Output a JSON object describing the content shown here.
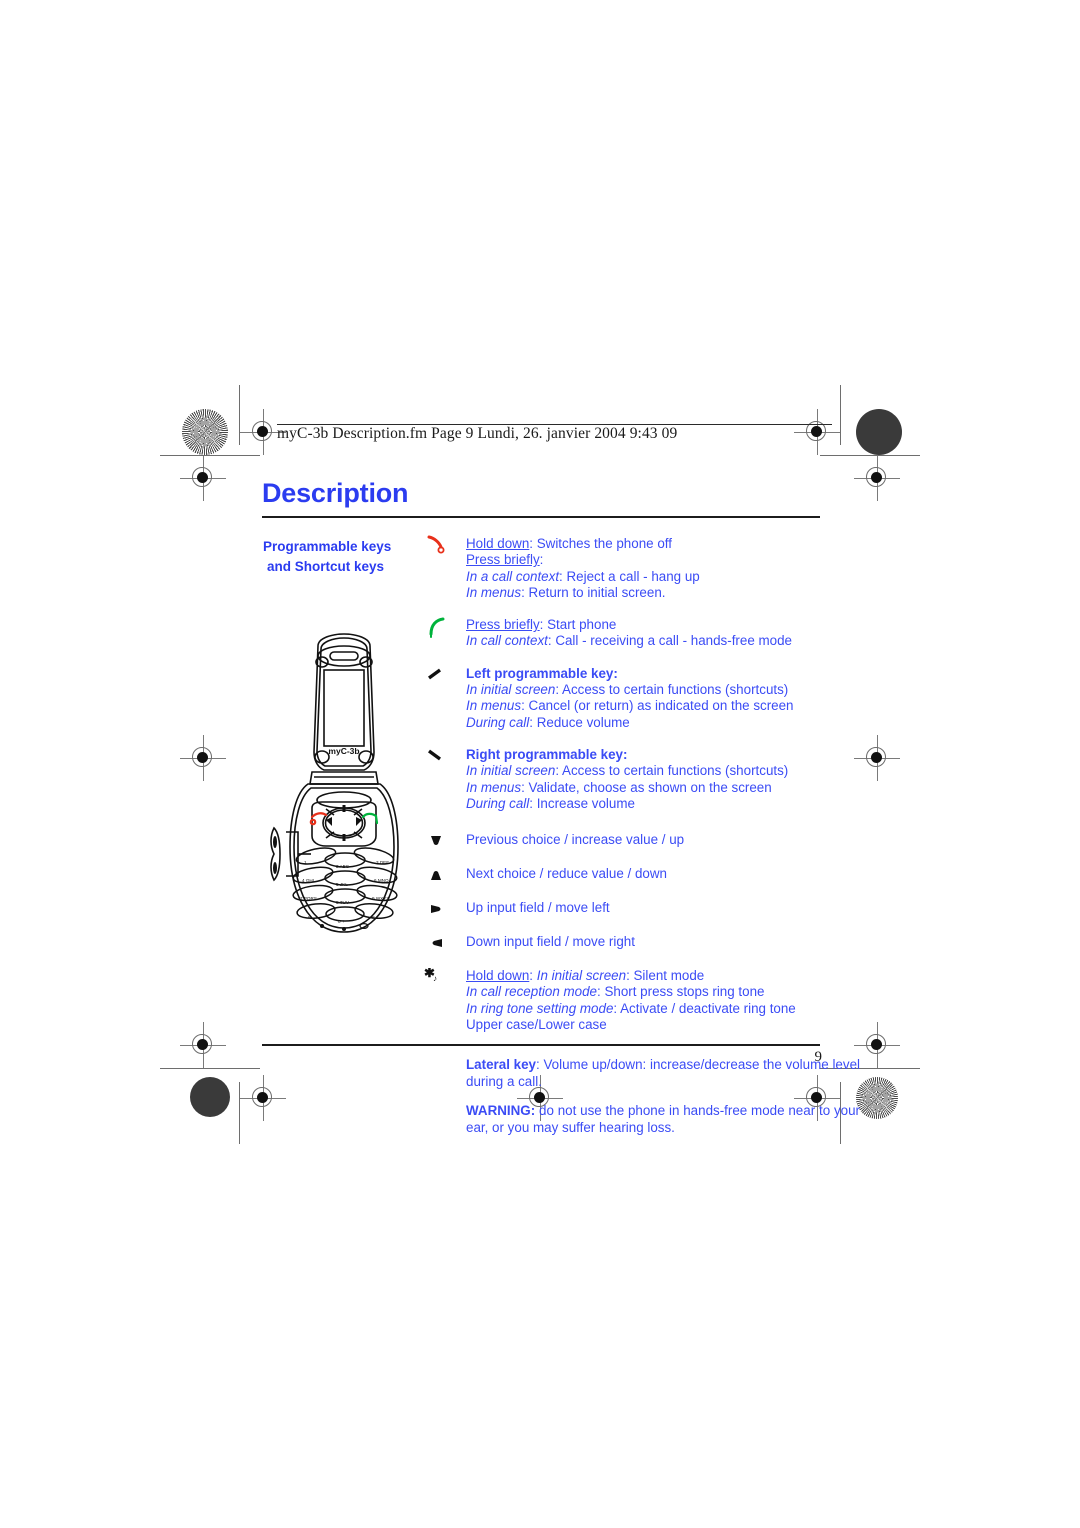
{
  "document": {
    "file_stamp": "myC-3b Description.fm  Page 9  Lundi, 26. janvier 2004  9:43 09",
    "title": "Description",
    "page_number": "9"
  },
  "sidebar": {
    "line1": "Programmable keys",
    "line2": "and  Shortcut keys"
  },
  "entries": [
    {
      "icon": "hang-up-icon",
      "lines": [
        "Hold down: Switches the phone off",
        "Press briefly:",
        "In a call context: Reject a call - hang up",
        "In menus: Return to initial screen."
      ]
    },
    {
      "icon": "call-icon",
      "lines": [
        "Press briefly: Start phone",
        "In call context: Call - receiving a call - hands-free mode"
      ]
    },
    {
      "icon": "left-programmable-key-icon",
      "lines": [
        "Left programmable key:",
        "In initial screen: Access to certain functions (shortcuts)",
        "In menus: Cancel (or return) as indicated on the screen",
        "During call: Reduce volume"
      ]
    },
    {
      "icon": "right-programmable-key-icon",
      "lines": [
        "Right programmable key:",
        "In initial screen: Access to certain functions (shortcuts)",
        "In menus: Validate, choose as shown on the screen",
        "During call: Increase volume"
      ]
    },
    {
      "icon": "nav-up-icon",
      "lines": [
        "Previous choice / increase value / up"
      ]
    },
    {
      "icon": "nav-down-icon",
      "lines": [
        "Next choice / reduce value / down"
      ]
    },
    {
      "icon": "nav-left-icon",
      "lines": [
        "Up input field / move left"
      ]
    },
    {
      "icon": "nav-right-icon",
      "lines": [
        "Down input field / move right"
      ]
    },
    {
      "icon": "star-key-icon",
      "lines": [
        "Hold down: In initial screen: Silent mode",
        "In call reception mode: Short press stops ring tone",
        "In ring tone setting mode: Activate / deactivate ring tone",
        "Upper case/Lower case"
      ]
    }
  ],
  "paragraphs": {
    "lateral_key_label": "Lateral key",
    "lateral_key_text": ": Volume up/down: increase/decrease the volume level during a call.",
    "warning_label": "WARNING:",
    "warning_text": " do not use the phone in hands-free mode near to your ear, or you may suffer hearing loss."
  },
  "phone": {
    "brand_label": "myC-3b",
    "keys": [
      "1",
      "2 ABC",
      "3 DEF",
      "4 GHI",
      "5 JKL",
      "6 MNO",
      "7 PQRS",
      "8 TUV",
      "9 WXYZ",
      "*",
      "0 +",
      "#"
    ]
  },
  "colors": {
    "heading_blue": "#2b3cf0",
    "body_blue": "#3b4cf5",
    "hang_up_red": "#e8301a",
    "call_green": "#00b33c",
    "rule_black": "#1c1c1c"
  }
}
